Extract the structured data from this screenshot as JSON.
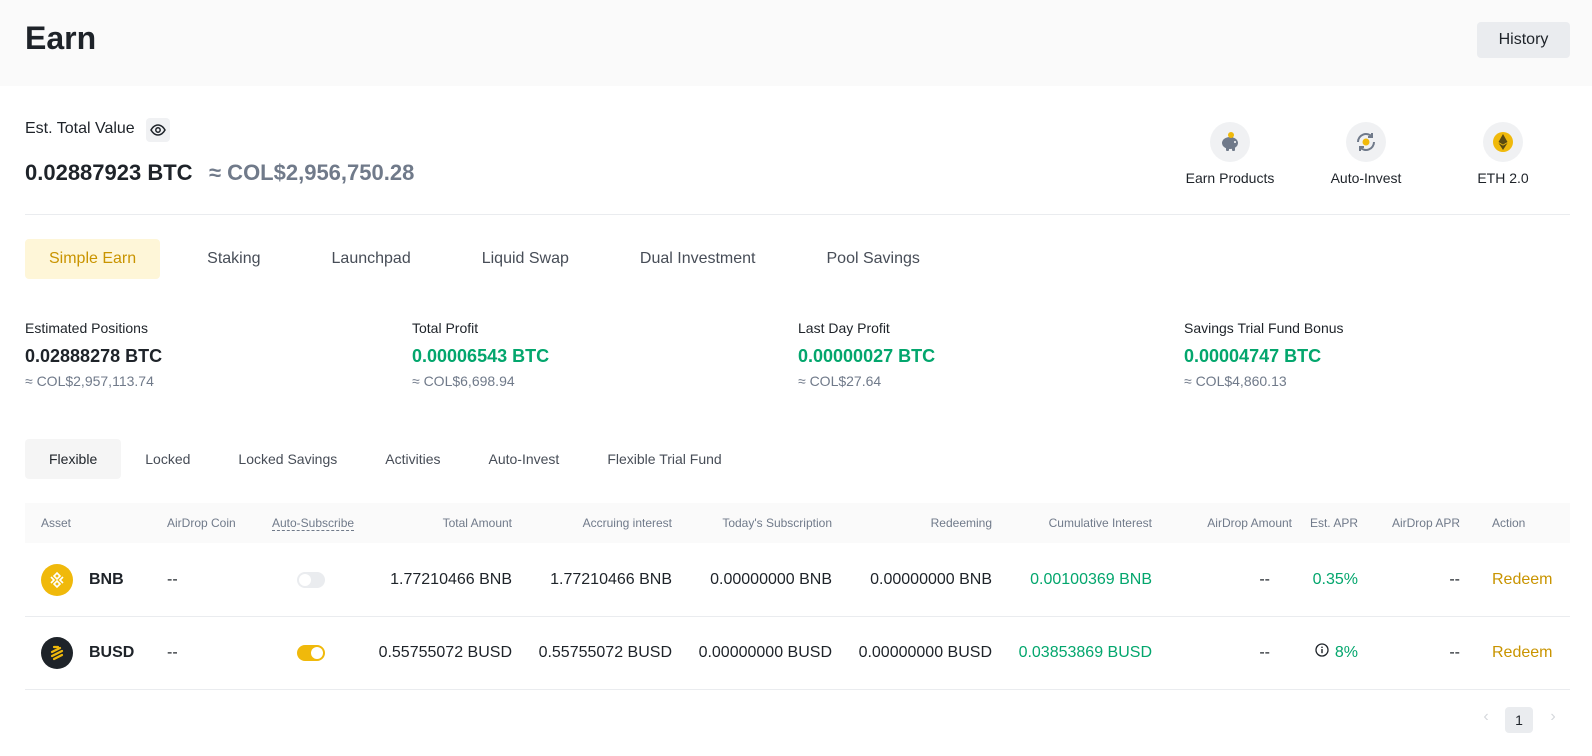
{
  "header": {
    "title": "Earn",
    "history_label": "History"
  },
  "summary": {
    "label": "Est. Total Value",
    "btc": "0.02887923 BTC",
    "fiat": "≈ COL$2,956,750.28"
  },
  "quick_links": [
    {
      "label": "Earn Products",
      "icon": "piggy-bank-icon"
    },
    {
      "label": "Auto-Invest",
      "icon": "auto-invest-icon"
    },
    {
      "label": "ETH 2.0",
      "icon": "eth-icon"
    }
  ],
  "product_tabs": [
    "Simple Earn",
    "Staking",
    "Launchpad",
    "Liquid Swap",
    "Dual Investment",
    "Pool Savings"
  ],
  "stats": [
    {
      "label": "Estimated Positions",
      "value": "0.02888278 BTC",
      "fiat": "≈ COL$2,957,113.74"
    },
    {
      "label": "Total Profit",
      "value": "0.00006543 BTC",
      "fiat": "≈ COL$6,698.94"
    },
    {
      "label": "Last Day Profit",
      "value": "0.00000027 BTC",
      "fiat": "≈ COL$27.64"
    },
    {
      "label": "Savings Trial Fund Bonus",
      "value": "0.00004747 BTC",
      "fiat": "≈ COL$4,860.13"
    }
  ],
  "sub_tabs": [
    "Flexible",
    "Locked",
    "Locked Savings",
    "Activities",
    "Auto-Invest",
    "Flexible Trial Fund"
  ],
  "table": {
    "columns": [
      "Asset",
      "AirDrop Coin",
      "Auto-Subscribe",
      "Total Amount",
      "Accruing interest",
      "Today's Subscription",
      "Redeeming",
      "Cumulative Interest",
      "AirDrop Amount",
      "Est. APR",
      "AirDrop APR",
      "Action"
    ],
    "rows": [
      {
        "asset": "BNB",
        "airdrop_coin": "--",
        "auto_subscribe": false,
        "total": "1.77210466 BNB",
        "accruing": "1.77210466 BNB",
        "today": "0.00000000 BNB",
        "redeeming": "0.00000000 BNB",
        "cumulative": "0.00100369 BNB",
        "airdrop_amount": "--",
        "apr": "0.35%",
        "airdrop_apr": "--",
        "action": "Redeem"
      },
      {
        "asset": "BUSD",
        "airdrop_coin": "--",
        "auto_subscribe": true,
        "total": "0.55755072 BUSD",
        "accruing": "0.55755072 BUSD",
        "today": "0.00000000 BUSD",
        "redeeming": "0.00000000 BUSD",
        "cumulative": "0.03853869 BUSD",
        "airdrop_amount": "--",
        "apr": "8%",
        "airdrop_apr": "--",
        "action": "Redeem"
      }
    ]
  },
  "pagination": {
    "current": "1"
  },
  "colors": {
    "accent": "#f0b90b",
    "accent_text": "#c99400",
    "positive": "#03a66d",
    "muted": "#707a8a"
  }
}
